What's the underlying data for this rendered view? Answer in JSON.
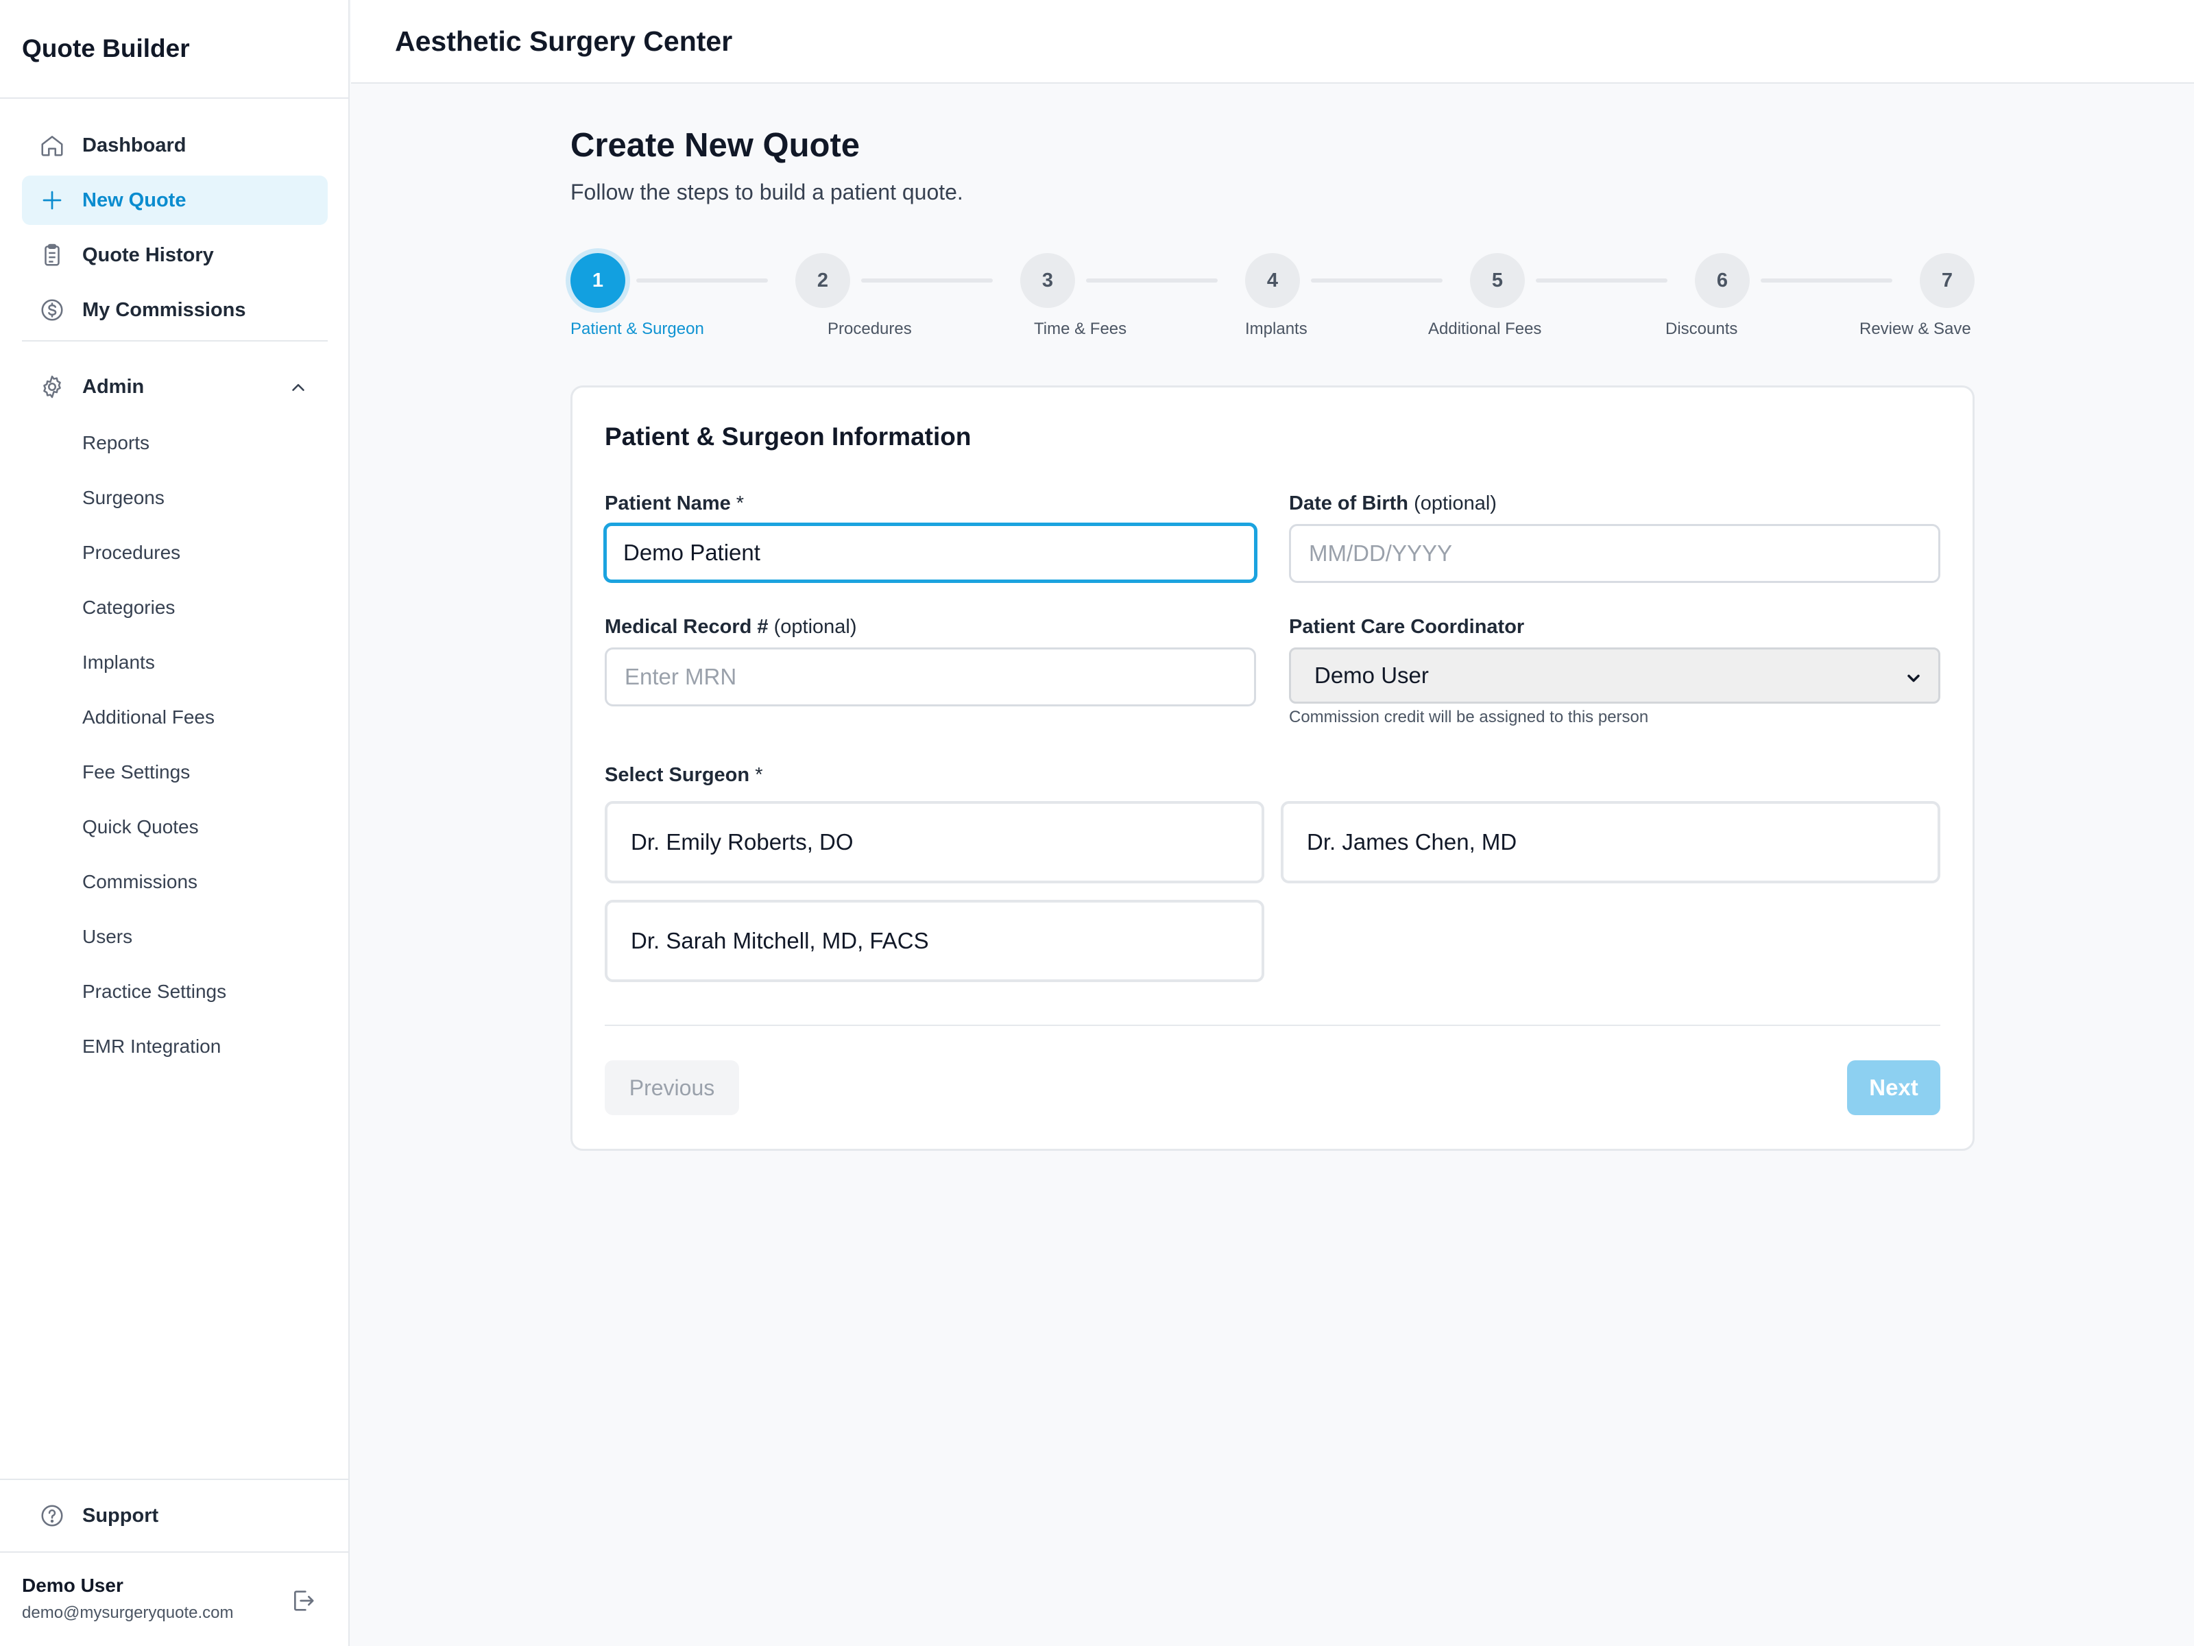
{
  "app": {
    "title": "Quote Builder"
  },
  "sidebar": {
    "items": [
      {
        "label": "Dashboard",
        "icon": "home-icon",
        "active": false
      },
      {
        "label": "New Quote",
        "icon": "plus-icon",
        "active": true
      },
      {
        "label": "Quote History",
        "icon": "clipboard-icon",
        "active": false
      },
      {
        "label": "My Commissions",
        "icon": "dollar-circle-icon",
        "active": false
      }
    ],
    "admin": {
      "label": "Admin",
      "icon": "gear-icon",
      "expanded": true,
      "items": [
        "Reports",
        "Surgeons",
        "Procedures",
        "Categories",
        "Implants",
        "Additional Fees",
        "Fee Settings",
        "Quick Quotes",
        "Commissions",
        "Users",
        "Practice Settings",
        "EMR Integration"
      ]
    },
    "support_label": "Support",
    "user": {
      "name": "Demo User",
      "email": "demo@mysurgeryquote.com"
    }
  },
  "header": {
    "title": "Aesthetic Surgery Center"
  },
  "main": {
    "title": "Create New Quote",
    "subtitle": "Follow the steps to build a patient quote.",
    "steps": [
      {
        "number": "1",
        "label": "Patient & Surgeon",
        "active": true
      },
      {
        "number": "2",
        "label": "Procedures",
        "active": false
      },
      {
        "number": "3",
        "label": "Time & Fees",
        "active": false
      },
      {
        "number": "4",
        "label": "Implants",
        "active": false
      },
      {
        "number": "5",
        "label": "Additional Fees",
        "active": false
      },
      {
        "number": "6",
        "label": "Discounts",
        "active": false
      },
      {
        "number": "7",
        "label": "Review & Save",
        "active": false
      }
    ],
    "form": {
      "section_title": "Patient & Surgeon Information",
      "patient_name": {
        "label": "Patient Name",
        "required_mark": "*",
        "value": "Demo Patient"
      },
      "dob": {
        "label": "Date of Birth",
        "optional_note": "(optional)",
        "placeholder": "MM/DD/YYYY",
        "value": ""
      },
      "mrn": {
        "label": "Medical Record #",
        "optional_note": "(optional)",
        "placeholder": "Enter MRN",
        "value": ""
      },
      "coordinator": {
        "label": "Patient Care Coordinator",
        "selected": "Demo User",
        "hint": "Commission credit will be assigned to this person"
      },
      "surgeon": {
        "label": "Select Surgeon",
        "required_mark": "*",
        "options": [
          "Dr. Emily Roberts, DO",
          "Dr. James Chen, MD",
          "Dr. Sarah Mitchell, MD, FACS"
        ]
      },
      "previous_label": "Previous",
      "next_label": "Next"
    }
  },
  "colors": {
    "accent": "#12a0e0",
    "active_nav_bg": "#e6f5fc",
    "active_nav_text": "#0b8ccf",
    "next_disabled": "#8dd0f1"
  }
}
